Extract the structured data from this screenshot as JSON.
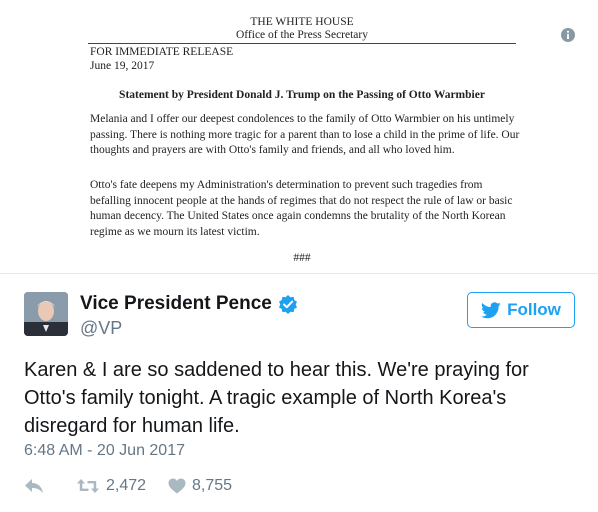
{
  "document": {
    "org": "THE WHITE HOUSE",
    "office": "Office of the Press Secretary",
    "release": "FOR IMMEDIATE RELEASE",
    "date": "June 19, 2017",
    "title": "Statement by President Donald J. Trump on the Passing of Otto Warmbier",
    "paragraph1": "Melania and I offer our deepest condolences to the family of Otto Warmbier on his untimely passing.  There is nothing more tragic for a parent than to lose a child in the prime of life.  Our thoughts and prayers are with Otto's family and friends, and all who loved him.",
    "paragraph2": "Otto's fate deepens my Administration's determination to prevent such tragedies from befalling innocent people at the hands of regimes that do not respect the rule of law or basic human decency.  The United States once again condemns the brutality of the North Korean regime as we mourn its latest victim.",
    "end_mark": "###"
  },
  "tweet": {
    "display_name": "Vice President Pence",
    "handle": "@VP",
    "follow_label": "Follow",
    "text": "Karen & I are so saddened to hear this. We're praying for Otto's family tonight. A tragic example of North Korea's disregard for human life.",
    "timestamp": "6:48 AM - 20 Jun 2017",
    "retweets": "2,472",
    "likes": "8,755"
  },
  "icons": {
    "info": "info-icon",
    "verified": "verified-badge-icon",
    "follow": "twitter-bird-icon",
    "reply": "reply-icon",
    "retweet": "retweet-icon",
    "like": "heart-icon"
  },
  "colors": {
    "twitter_blue": "#1da1f2",
    "secondary_text": "#657786",
    "primary_text": "#14171a",
    "icon_gray": "#aab8c2"
  }
}
